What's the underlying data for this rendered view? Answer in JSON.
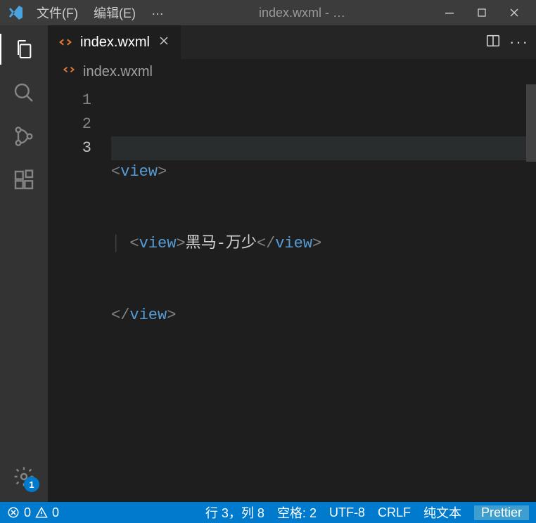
{
  "titlebar": {
    "menu_file": "文件(F)",
    "menu_edit": "编辑(E)",
    "menu_ellipsis": "…",
    "window_title": "index.wxml - …"
  },
  "tab": {
    "label": "index.wxml"
  },
  "breadcrumb": {
    "label": "index.wxml"
  },
  "gutter": {
    "l1": "1",
    "l2": "2",
    "l3": "3"
  },
  "code": {
    "l1_open_lt": "<",
    "l1_tag": "view",
    "l1_open_gt": ">",
    "l2_open_lt": "<",
    "l2_tag_open": "view",
    "l2_open_gt": ">",
    "l2_text": "黑马-万少",
    "l2_close_lt": "</",
    "l2_tag_close": "view",
    "l2_close_gt": ">",
    "l3_close_lt": "</",
    "l3_tag": "view",
    "l3_close_gt": ">"
  },
  "settings_badge": "1",
  "status": {
    "errors": "0",
    "warnings": "0",
    "cursor": "行 3，列 8",
    "spaces": "空格: 2",
    "encoding": "UTF-8",
    "eol": "CRLF",
    "language": "纯文本",
    "prettier": "Prettier"
  }
}
